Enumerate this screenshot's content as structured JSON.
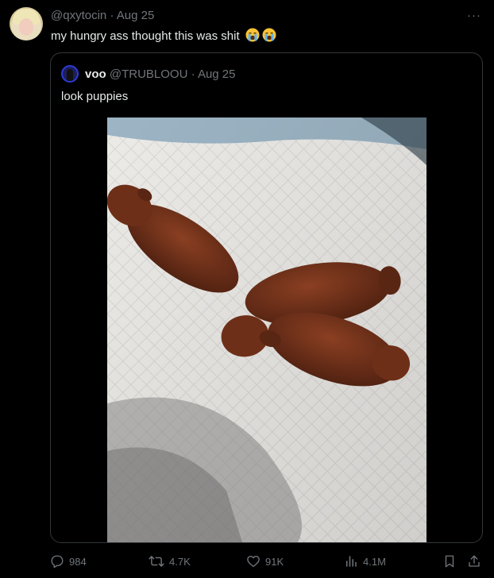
{
  "tweet": {
    "handle": "@qxytocin",
    "date": "Aug 25",
    "separator": "·",
    "text": "my hungry ass thought this was shit",
    "emoji": [
      "loudly-crying-face",
      "loudly-crying-face"
    ],
    "more_label": "···"
  },
  "quote": {
    "name": "voo",
    "handle": "@TRUBLOOU",
    "date": "Aug 25",
    "text": "look puppies",
    "image": "photo of three brown puppies on a white pad"
  },
  "actions": {
    "replies": "984",
    "reposts": "4.7K",
    "likes": "91K",
    "views": "4.1M"
  },
  "colors": {
    "background": "#000000",
    "text": "#e7e9ea",
    "muted": "#71767b",
    "border": "#333639"
  }
}
